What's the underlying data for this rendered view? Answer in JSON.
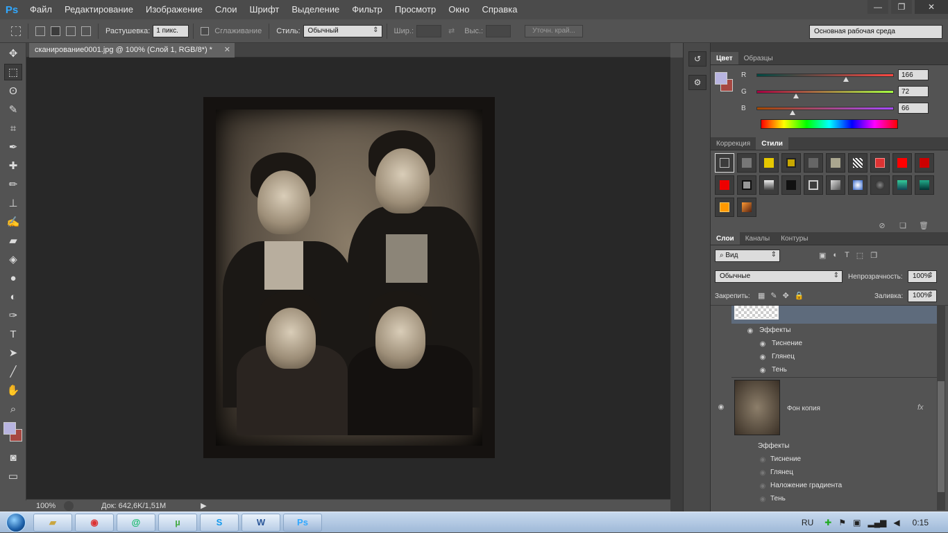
{
  "app": {
    "logo": "Ps",
    "menu": [
      "Файл",
      "Редактирование",
      "Изображение",
      "Слои",
      "Шрифт",
      "Выделение",
      "Фильтр",
      "Просмотр",
      "Окно",
      "Справка"
    ],
    "window_controls": {
      "minimize": "—",
      "restore": "❐",
      "close": "✕"
    }
  },
  "options": {
    "feather_label": "Растушевка:",
    "feather_value": "1 пикс.",
    "antialias_label": "Сглаживание",
    "style_label": "Стиль:",
    "style_value": "Обычный",
    "width_label": "Шир.:",
    "height_label": "Выс.:",
    "refine_edge": "Уточн. край...",
    "workspace": "Основная рабочая среда"
  },
  "document": {
    "tab_title": "сканирование0001.jpg @ 100% (Слой 1, RGB/8*) *",
    "zoom": "100%",
    "doc_size": "Док: 642,6K/1,51M"
  },
  "color_panel": {
    "tabs": [
      "Цвет",
      "Образцы"
    ],
    "r_label": "R",
    "g_label": "G",
    "b_label": "B",
    "r": 166,
    "g": 72,
    "b": 66,
    "fg_color": "#b8b4e0",
    "bg_color": "#a64842"
  },
  "styles_panel": {
    "tabs": [
      "Коррекция",
      "Стили"
    ]
  },
  "layers_panel": {
    "tabs": [
      "Слои",
      "Каналы",
      "Контуры"
    ],
    "filter": "Вид",
    "blend_mode": "Обычные",
    "opacity_label": "Непрозрачность:",
    "opacity": "100%",
    "lock_label": "Закрепить:",
    "fill_label": "Заливка:",
    "fill": "100%",
    "layer1_effects": [
      "Эффекты",
      "Тиснение",
      "Глянец",
      "Тень"
    ],
    "layer2_name": "Фон копия",
    "layer2_fx": "fx",
    "layer2_effects": [
      "Эффекты",
      "Тиснение",
      "Глянец",
      "Наложение градиента",
      "Тень"
    ]
  },
  "taskbar": {
    "lang": "RU",
    "time": "0:15",
    "apps": [
      "folder-icon",
      "chrome-icon",
      "mail-icon",
      "utorrent-icon",
      "skype-icon",
      "word-icon",
      "photoshop-icon"
    ]
  }
}
